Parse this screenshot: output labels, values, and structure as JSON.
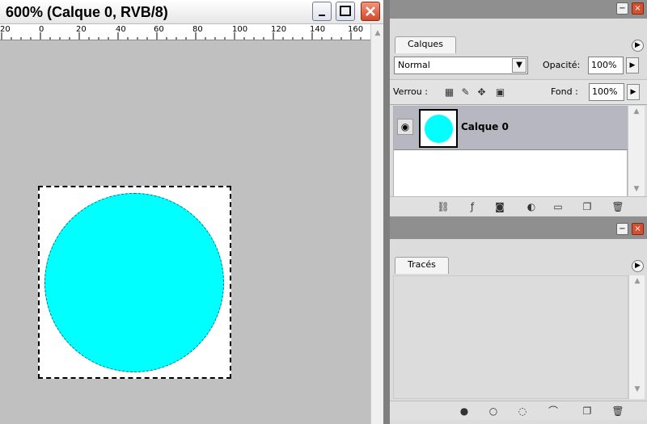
{
  "document": {
    "title": "600% (Calque 0, RVB/8)",
    "window_buttons": {
      "minimize": "minimize-icon",
      "maximize": "maximize-icon",
      "close": "close-icon"
    },
    "ruler_labels": [
      "20",
      "0",
      "20",
      "40",
      "60",
      "80",
      "100",
      "120",
      "140",
      "160"
    ],
    "canvas_color": "#ffffff",
    "shape_color": "#00ffff"
  },
  "layers_panel": {
    "tab": "Calques",
    "blend_mode": "Normal",
    "opacity_label": "Opacité:",
    "opacity_value": "100%",
    "lock_label": "Verrou :",
    "fill_label": "Fond :",
    "fill_value": "100%",
    "layer": {
      "name": "Calque 0"
    }
  },
  "paths_panel": {
    "tab": "Tracés"
  }
}
